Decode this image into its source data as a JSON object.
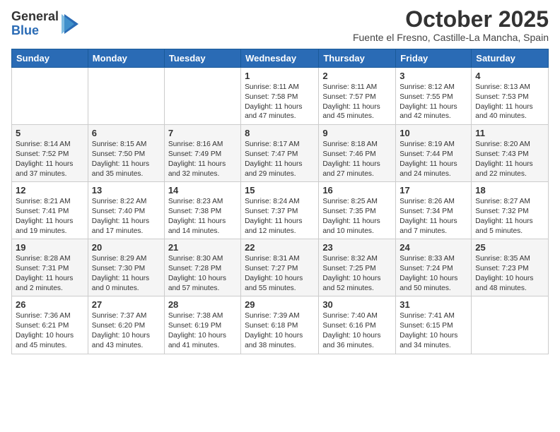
{
  "logo": {
    "general": "General",
    "blue": "Blue"
  },
  "header": {
    "month": "October 2025",
    "location": "Fuente el Fresno, Castille-La Mancha, Spain"
  },
  "days": [
    "Sunday",
    "Monday",
    "Tuesday",
    "Wednesday",
    "Thursday",
    "Friday",
    "Saturday"
  ],
  "weeks": [
    [
      {
        "day": "",
        "content": ""
      },
      {
        "day": "",
        "content": ""
      },
      {
        "day": "",
        "content": ""
      },
      {
        "day": "1",
        "content": "Sunrise: 8:11 AM\nSunset: 7:58 PM\nDaylight: 11 hours and 47 minutes."
      },
      {
        "day": "2",
        "content": "Sunrise: 8:11 AM\nSunset: 7:57 PM\nDaylight: 11 hours and 45 minutes."
      },
      {
        "day": "3",
        "content": "Sunrise: 8:12 AM\nSunset: 7:55 PM\nDaylight: 11 hours and 42 minutes."
      },
      {
        "day": "4",
        "content": "Sunrise: 8:13 AM\nSunset: 7:53 PM\nDaylight: 11 hours and 40 minutes."
      }
    ],
    [
      {
        "day": "5",
        "content": "Sunrise: 8:14 AM\nSunset: 7:52 PM\nDaylight: 11 hours and 37 minutes."
      },
      {
        "day": "6",
        "content": "Sunrise: 8:15 AM\nSunset: 7:50 PM\nDaylight: 11 hours and 35 minutes."
      },
      {
        "day": "7",
        "content": "Sunrise: 8:16 AM\nSunset: 7:49 PM\nDaylight: 11 hours and 32 minutes."
      },
      {
        "day": "8",
        "content": "Sunrise: 8:17 AM\nSunset: 7:47 PM\nDaylight: 11 hours and 29 minutes."
      },
      {
        "day": "9",
        "content": "Sunrise: 8:18 AM\nSunset: 7:46 PM\nDaylight: 11 hours and 27 minutes."
      },
      {
        "day": "10",
        "content": "Sunrise: 8:19 AM\nSunset: 7:44 PM\nDaylight: 11 hours and 24 minutes."
      },
      {
        "day": "11",
        "content": "Sunrise: 8:20 AM\nSunset: 7:43 PM\nDaylight: 11 hours and 22 minutes."
      }
    ],
    [
      {
        "day": "12",
        "content": "Sunrise: 8:21 AM\nSunset: 7:41 PM\nDaylight: 11 hours and 19 minutes."
      },
      {
        "day": "13",
        "content": "Sunrise: 8:22 AM\nSunset: 7:40 PM\nDaylight: 11 hours and 17 minutes."
      },
      {
        "day": "14",
        "content": "Sunrise: 8:23 AM\nSunset: 7:38 PM\nDaylight: 11 hours and 14 minutes."
      },
      {
        "day": "15",
        "content": "Sunrise: 8:24 AM\nSunset: 7:37 PM\nDaylight: 11 hours and 12 minutes."
      },
      {
        "day": "16",
        "content": "Sunrise: 8:25 AM\nSunset: 7:35 PM\nDaylight: 11 hours and 10 minutes."
      },
      {
        "day": "17",
        "content": "Sunrise: 8:26 AM\nSunset: 7:34 PM\nDaylight: 11 hours and 7 minutes."
      },
      {
        "day": "18",
        "content": "Sunrise: 8:27 AM\nSunset: 7:32 PM\nDaylight: 11 hours and 5 minutes."
      }
    ],
    [
      {
        "day": "19",
        "content": "Sunrise: 8:28 AM\nSunset: 7:31 PM\nDaylight: 11 hours and 2 minutes."
      },
      {
        "day": "20",
        "content": "Sunrise: 8:29 AM\nSunset: 7:30 PM\nDaylight: 11 hours and 0 minutes."
      },
      {
        "day": "21",
        "content": "Sunrise: 8:30 AM\nSunset: 7:28 PM\nDaylight: 10 hours and 57 minutes."
      },
      {
        "day": "22",
        "content": "Sunrise: 8:31 AM\nSunset: 7:27 PM\nDaylight: 10 hours and 55 minutes."
      },
      {
        "day": "23",
        "content": "Sunrise: 8:32 AM\nSunset: 7:25 PM\nDaylight: 10 hours and 52 minutes."
      },
      {
        "day": "24",
        "content": "Sunrise: 8:33 AM\nSunset: 7:24 PM\nDaylight: 10 hours and 50 minutes."
      },
      {
        "day": "25",
        "content": "Sunrise: 8:35 AM\nSunset: 7:23 PM\nDaylight: 10 hours and 48 minutes."
      }
    ],
    [
      {
        "day": "26",
        "content": "Sunrise: 7:36 AM\nSunset: 6:21 PM\nDaylight: 10 hours and 45 minutes."
      },
      {
        "day": "27",
        "content": "Sunrise: 7:37 AM\nSunset: 6:20 PM\nDaylight: 10 hours and 43 minutes."
      },
      {
        "day": "28",
        "content": "Sunrise: 7:38 AM\nSunset: 6:19 PM\nDaylight: 10 hours and 41 minutes."
      },
      {
        "day": "29",
        "content": "Sunrise: 7:39 AM\nSunset: 6:18 PM\nDaylight: 10 hours and 38 minutes."
      },
      {
        "day": "30",
        "content": "Sunrise: 7:40 AM\nSunset: 6:16 PM\nDaylight: 10 hours and 36 minutes."
      },
      {
        "day": "31",
        "content": "Sunrise: 7:41 AM\nSunset: 6:15 PM\nDaylight: 10 hours and 34 minutes."
      },
      {
        "day": "",
        "content": ""
      }
    ]
  ]
}
